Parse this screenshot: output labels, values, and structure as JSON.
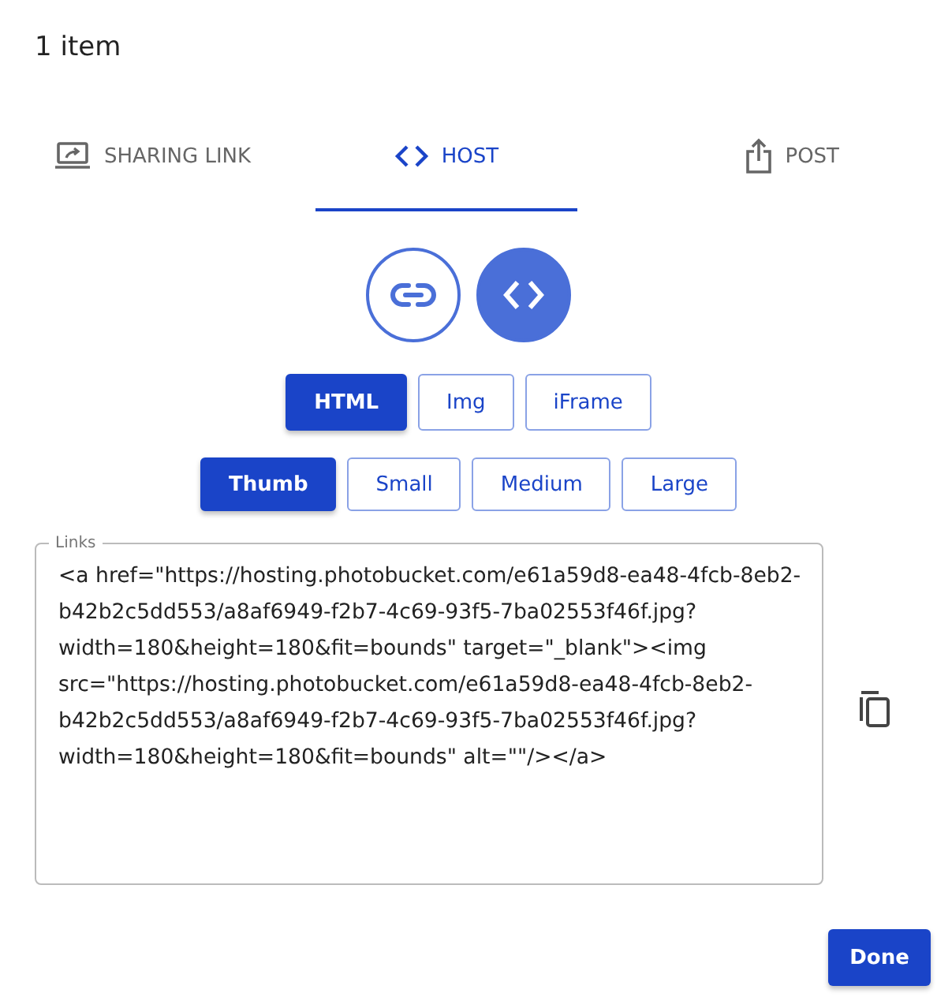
{
  "title": "1 item",
  "tabs": [
    {
      "kind": "laptop",
      "label": "SHARING LINK",
      "selected": false
    },
    {
      "kind": "code",
      "label": "HOST",
      "selected": true
    },
    {
      "kind": "share",
      "label": "POST",
      "selected": false
    }
  ],
  "modes": [
    {
      "kind": "link",
      "selected": false
    },
    {
      "kind": "code",
      "selected": true
    }
  ],
  "formats": [
    {
      "label": "HTML",
      "selected": true
    },
    {
      "label": "Img",
      "selected": false
    },
    {
      "label": "iFrame",
      "selected": false
    }
  ],
  "sizes": [
    {
      "label": "Thumb",
      "selected": true
    },
    {
      "label": "Small",
      "selected": false
    },
    {
      "label": "Medium",
      "selected": false
    },
    {
      "label": "Large",
      "selected": false
    }
  ],
  "links": {
    "label": "Links",
    "value": "<a href=\"https://hosting.photobucket.com/e61a59d8-ea48-4fcb-8eb2-b42b2c5dd553/a8af6949-f2b7-4c69-93f5-7ba02553f46f.jpg?width=180&height=180&fit=bounds\" target=\"_blank\"><img src=\"https://hosting.photobucket.com/e61a59d8-ea48-4fcb-8eb2-b42b2c5dd553/a8af6949-f2b7-4c69-93f5-7ba02553f46f.jpg?width=180&height=180&fit=bounds\" alt=\"\"/></a>"
  },
  "done_button": "Done"
}
